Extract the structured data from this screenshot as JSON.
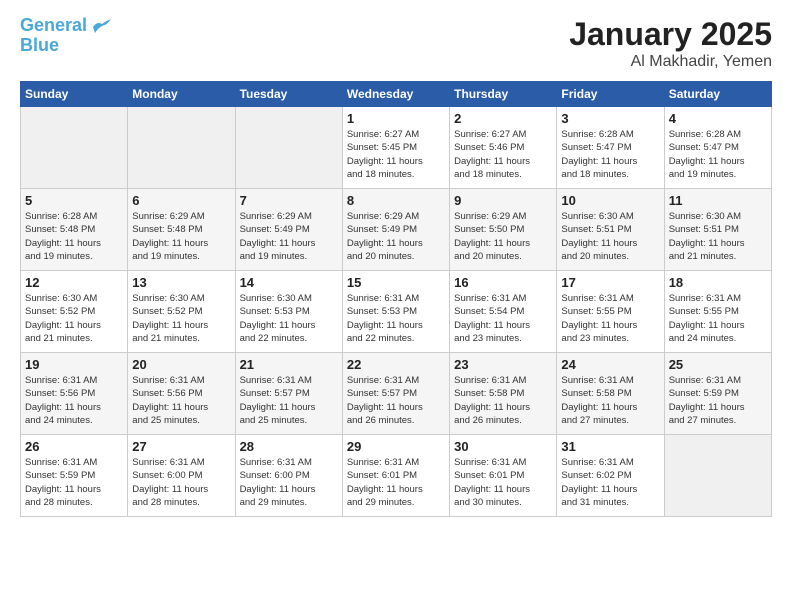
{
  "logo": {
    "line1": "General",
    "line2": "Blue"
  },
  "title": "January 2025",
  "subtitle": "Al Makhadir, Yemen",
  "weekdays": [
    "Sunday",
    "Monday",
    "Tuesday",
    "Wednesday",
    "Thursday",
    "Friday",
    "Saturday"
  ],
  "weeks": [
    [
      {
        "day": "",
        "info": ""
      },
      {
        "day": "",
        "info": ""
      },
      {
        "day": "",
        "info": ""
      },
      {
        "day": "1",
        "info": "Sunrise: 6:27 AM\nSunset: 5:45 PM\nDaylight: 11 hours\nand 18 minutes."
      },
      {
        "day": "2",
        "info": "Sunrise: 6:27 AM\nSunset: 5:46 PM\nDaylight: 11 hours\nand 18 minutes."
      },
      {
        "day": "3",
        "info": "Sunrise: 6:28 AM\nSunset: 5:47 PM\nDaylight: 11 hours\nand 18 minutes."
      },
      {
        "day": "4",
        "info": "Sunrise: 6:28 AM\nSunset: 5:47 PM\nDaylight: 11 hours\nand 19 minutes."
      }
    ],
    [
      {
        "day": "5",
        "info": "Sunrise: 6:28 AM\nSunset: 5:48 PM\nDaylight: 11 hours\nand 19 minutes."
      },
      {
        "day": "6",
        "info": "Sunrise: 6:29 AM\nSunset: 5:48 PM\nDaylight: 11 hours\nand 19 minutes."
      },
      {
        "day": "7",
        "info": "Sunrise: 6:29 AM\nSunset: 5:49 PM\nDaylight: 11 hours\nand 19 minutes."
      },
      {
        "day": "8",
        "info": "Sunrise: 6:29 AM\nSunset: 5:49 PM\nDaylight: 11 hours\nand 20 minutes."
      },
      {
        "day": "9",
        "info": "Sunrise: 6:29 AM\nSunset: 5:50 PM\nDaylight: 11 hours\nand 20 minutes."
      },
      {
        "day": "10",
        "info": "Sunrise: 6:30 AM\nSunset: 5:51 PM\nDaylight: 11 hours\nand 20 minutes."
      },
      {
        "day": "11",
        "info": "Sunrise: 6:30 AM\nSunset: 5:51 PM\nDaylight: 11 hours\nand 21 minutes."
      }
    ],
    [
      {
        "day": "12",
        "info": "Sunrise: 6:30 AM\nSunset: 5:52 PM\nDaylight: 11 hours\nand 21 minutes."
      },
      {
        "day": "13",
        "info": "Sunrise: 6:30 AM\nSunset: 5:52 PM\nDaylight: 11 hours\nand 21 minutes."
      },
      {
        "day": "14",
        "info": "Sunrise: 6:30 AM\nSunset: 5:53 PM\nDaylight: 11 hours\nand 22 minutes."
      },
      {
        "day": "15",
        "info": "Sunrise: 6:31 AM\nSunset: 5:53 PM\nDaylight: 11 hours\nand 22 minutes."
      },
      {
        "day": "16",
        "info": "Sunrise: 6:31 AM\nSunset: 5:54 PM\nDaylight: 11 hours\nand 23 minutes."
      },
      {
        "day": "17",
        "info": "Sunrise: 6:31 AM\nSunset: 5:55 PM\nDaylight: 11 hours\nand 23 minutes."
      },
      {
        "day": "18",
        "info": "Sunrise: 6:31 AM\nSunset: 5:55 PM\nDaylight: 11 hours\nand 24 minutes."
      }
    ],
    [
      {
        "day": "19",
        "info": "Sunrise: 6:31 AM\nSunset: 5:56 PM\nDaylight: 11 hours\nand 24 minutes."
      },
      {
        "day": "20",
        "info": "Sunrise: 6:31 AM\nSunset: 5:56 PM\nDaylight: 11 hours\nand 25 minutes."
      },
      {
        "day": "21",
        "info": "Sunrise: 6:31 AM\nSunset: 5:57 PM\nDaylight: 11 hours\nand 25 minutes."
      },
      {
        "day": "22",
        "info": "Sunrise: 6:31 AM\nSunset: 5:57 PM\nDaylight: 11 hours\nand 26 minutes."
      },
      {
        "day": "23",
        "info": "Sunrise: 6:31 AM\nSunset: 5:58 PM\nDaylight: 11 hours\nand 26 minutes."
      },
      {
        "day": "24",
        "info": "Sunrise: 6:31 AM\nSunset: 5:58 PM\nDaylight: 11 hours\nand 27 minutes."
      },
      {
        "day": "25",
        "info": "Sunrise: 6:31 AM\nSunset: 5:59 PM\nDaylight: 11 hours\nand 27 minutes."
      }
    ],
    [
      {
        "day": "26",
        "info": "Sunrise: 6:31 AM\nSunset: 5:59 PM\nDaylight: 11 hours\nand 28 minutes."
      },
      {
        "day": "27",
        "info": "Sunrise: 6:31 AM\nSunset: 6:00 PM\nDaylight: 11 hours\nand 28 minutes."
      },
      {
        "day": "28",
        "info": "Sunrise: 6:31 AM\nSunset: 6:00 PM\nDaylight: 11 hours\nand 29 minutes."
      },
      {
        "day": "29",
        "info": "Sunrise: 6:31 AM\nSunset: 6:01 PM\nDaylight: 11 hours\nand 29 minutes."
      },
      {
        "day": "30",
        "info": "Sunrise: 6:31 AM\nSunset: 6:01 PM\nDaylight: 11 hours\nand 30 minutes."
      },
      {
        "day": "31",
        "info": "Sunrise: 6:31 AM\nSunset: 6:02 PM\nDaylight: 11 hours\nand 31 minutes."
      },
      {
        "day": "",
        "info": ""
      }
    ]
  ]
}
